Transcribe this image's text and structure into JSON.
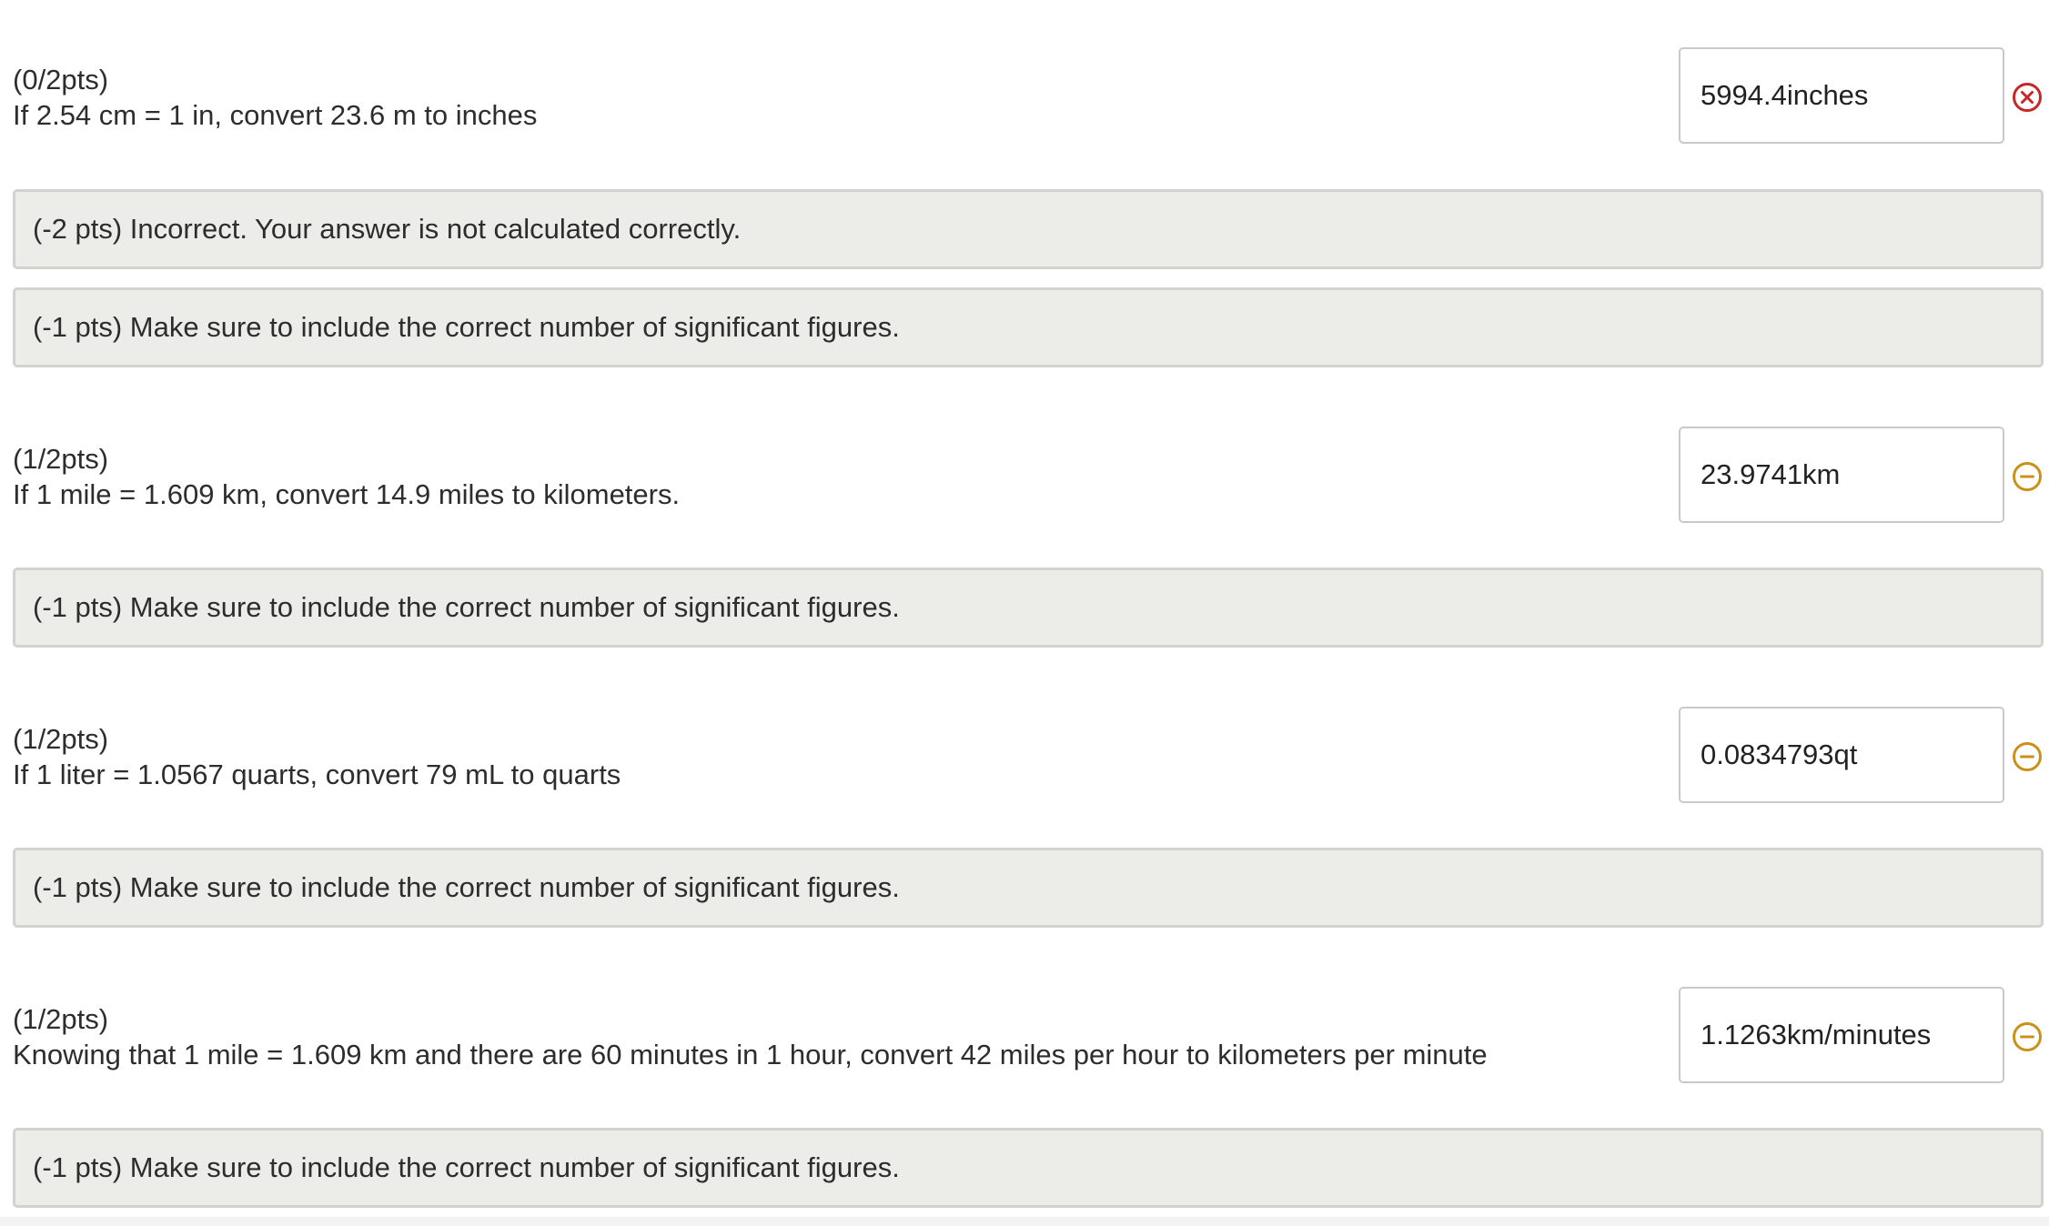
{
  "icons": {
    "incorrect": {
      "name": "circle-x-icon",
      "color": "#c62828"
    },
    "partial": {
      "name": "circle-minus-icon",
      "color": "#c9911a"
    }
  },
  "questions": [
    {
      "score": "(0/2pts)",
      "prompt": "If 2.54 cm = 1 in, convert 23.6 m to inches",
      "answer": "5994.4inches",
      "status": "incorrect",
      "feedback": [
        "(-2 pts) Incorrect. Your answer is not calculated correctly.",
        "(-1 pts) Make sure to include the correct number of significant figures."
      ]
    },
    {
      "score": "(1/2pts)",
      "prompt": "If 1 mile = 1.609 km, convert 14.9 miles to kilometers.",
      "answer": "23.9741km",
      "status": "partial",
      "feedback": [
        "(-1 pts) Make sure to include the correct number of significant figures."
      ]
    },
    {
      "score": "(1/2pts)",
      "prompt": "If 1 liter = 1.0567 quarts, convert 79 mL to quarts",
      "answer": "0.0834793qt",
      "status": "partial",
      "feedback": [
        "(-1 pts) Make sure to include the correct number of significant figures."
      ]
    },
    {
      "score": "(1/2pts)",
      "prompt": "Knowing that 1 mile = 1.609 km and there are 60 minutes in 1 hour, convert 42 miles per hour to kilometers per minute",
      "answer": "1.1263km/minutes",
      "status": "partial",
      "feedback": [
        "(-1 pts) Make sure to include the correct number of significant figures."
      ]
    }
  ]
}
